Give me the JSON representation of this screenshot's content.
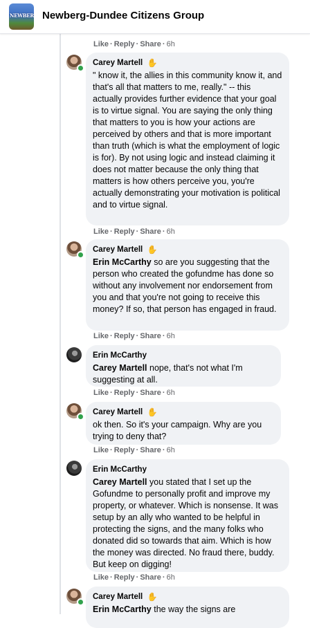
{
  "header": {
    "group_name": "Newberg-Dundee Citizens Group",
    "group_logo_text": "NEWBERG"
  },
  "actions": {
    "like": "Like",
    "reply": "Reply",
    "share": "Share",
    "dot": "·"
  },
  "top_meta": {
    "time": "6h"
  },
  "comments": [
    {
      "author": "Carey Martell",
      "mention": "",
      "text": "\" know it, the allies in this community know it, and that's all that matters to me, really.\" -- this actually provides further evidence that your goal is to virtue signal. You are saying the only thing that matters to you is how your actions are perceived by others and that is more important than truth (which is what the employment of logic is for). By not using logic and instead claiming it does not matter because the only thing that matters is how others perceive you, you're actually demonstrating your motivation is political and to virtue signal.",
      "time": "6h"
    },
    {
      "author": "Carey Martell",
      "mention": "Erin McCarthy",
      "text": " so are you suggesting that the person who created the gofundme has done so without any involvement nor endorsement from you and that you're not going to receive this money? If so, that person has engaged in fraud.",
      "time": "6h"
    },
    {
      "author": "Erin McCarthy",
      "mention": "Carey Martell",
      "text": " nope, that's not what I'm suggesting at all.",
      "time": "6h"
    },
    {
      "author": "Carey Martell",
      "mention": "",
      "text": "ok then. So it's your campaign. Why are you trying to deny that?",
      "time": "6h"
    },
    {
      "author": "Erin McCarthy",
      "mention": "Carey Martell",
      "text": " you stated that I set up the Gofundme to personally profit and improve my property, or whatever. Which is nonsense. It was setup by an ally who wanted to be helpful in protecting the signs, and the many folks who donated did so towards that aim. Which is how the money was directed. No fraud there, buddy. But keep on digging!",
      "time": "6h"
    },
    {
      "author": "Carey Martell",
      "mention": "Erin McCarthy",
      "text": " the way the signs are",
      "time": ""
    }
  ],
  "colors": {
    "bubble": "#f0f2f5",
    "meta": "#65676b",
    "online": "#31a24c"
  }
}
